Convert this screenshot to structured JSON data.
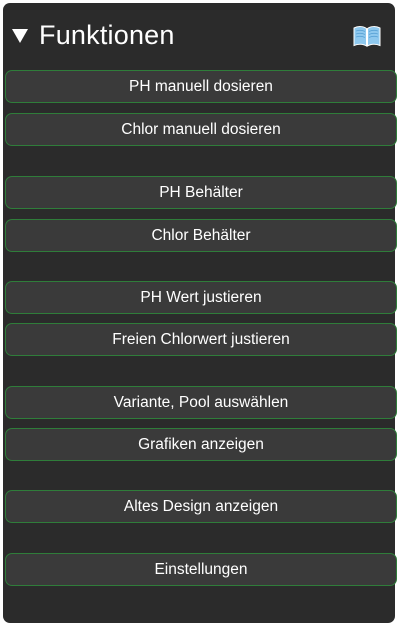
{
  "panel": {
    "title": "Funktionen",
    "toggle_icon": "triangle-down-icon",
    "help_icon": "open-book-icon"
  },
  "buttons": [
    {
      "id": "ph-manual-dose",
      "label": "PH manuell dosieren"
    },
    {
      "id": "chlorine-manual-dose",
      "label": "Chlor manuell dosieren"
    },
    {
      "id": "ph-container",
      "label": "PH Behälter"
    },
    {
      "id": "chlorine-container",
      "label": "Chlor Behälter"
    },
    {
      "id": "ph-adjust",
      "label": "PH Wert justieren"
    },
    {
      "id": "free-chlorine-adjust",
      "label": "Freien Chlorwert justieren"
    },
    {
      "id": "select-variant-pool",
      "label": "Variante, Pool auswählen"
    },
    {
      "id": "show-graphics",
      "label": "Grafiken anzeigen"
    },
    {
      "id": "show-old-design",
      "label": "Altes Design anzeigen"
    },
    {
      "id": "settings",
      "label": "Einstellungen"
    }
  ],
  "colors": {
    "panel_background": "#2b2b2b",
    "button_background": "#3a3a3a",
    "button_border": "#2f7d3a",
    "text": "#ffffff",
    "book_icon": "#8ec8ee"
  }
}
